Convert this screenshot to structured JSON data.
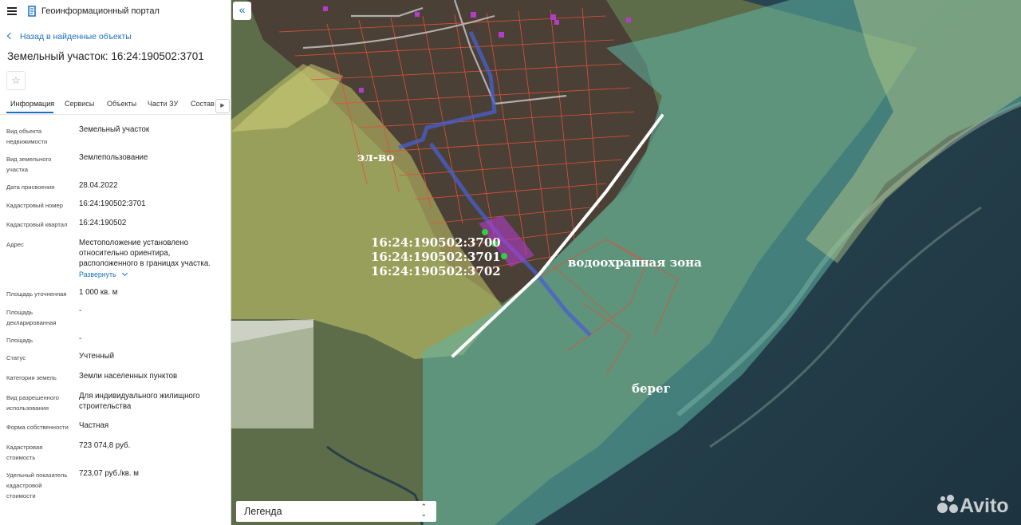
{
  "app": {
    "title": "Геоинформационный портал"
  },
  "nav": {
    "back_label": "Назад в найденные объекты"
  },
  "object": {
    "title": "Земельный участок: 16:24:190502:3701"
  },
  "tabs": [
    {
      "label": "Информация",
      "active": true
    },
    {
      "label": "Сервисы"
    },
    {
      "label": "Объекты"
    },
    {
      "label": "Части ЗУ"
    },
    {
      "label": "Состав"
    }
  ],
  "properties": [
    {
      "label": "Вид объекта недвижимости",
      "value": "Земельный участок"
    },
    {
      "label": "Вид земельного участка",
      "value": "Землепользование"
    },
    {
      "label": "Дата присвоения",
      "value": "28.04.2022"
    },
    {
      "label": "Кадастровый номер",
      "value": "16:24:190502:3701"
    },
    {
      "label": "Кадастровый квартал",
      "value": "16:24:190502"
    },
    {
      "label": "Адрес",
      "value": "Местоположение установлено относительно ориентира, расположенного в границах участка.",
      "action": "Развернуть"
    },
    {
      "label": "Площадь уточненная",
      "value": "1 000 кв. м"
    },
    {
      "label": "Площадь декларированная",
      "value": "-"
    },
    {
      "label": "Площадь",
      "value": "-"
    },
    {
      "label": "Статус",
      "value": "Учтенный"
    },
    {
      "label": "Категория земель",
      "value": "Земли населенных пунктов"
    },
    {
      "label": "Вид разрешенного использования",
      "value": "Для индивидуального жилищного строительства"
    },
    {
      "label": "Форма собственности",
      "value": "Частная"
    },
    {
      "label": "Кадастровая стоимость",
      "value": "723 074,8 руб."
    },
    {
      "label": "Удельный показатель кадастровой стоимости",
      "value": "723,07 руб./кв. м"
    }
  ],
  "map": {
    "collapse_icon": "«",
    "legend_label": "Легенда",
    "legend_arrows": "⌃⌄",
    "annotations": {
      "power_line": "эл-во",
      "parcel_1": "16:24:190502:3700",
      "parcel_2": "16:24:190502:3701",
      "parcel_3": "16:24:190502:3702",
      "water_zone": "водоохранная зона",
      "shore": "берег"
    },
    "watermark": "Avito",
    "colors": {
      "yellow_zone": "#c9c96a",
      "water_zone": "#5fb4a4",
      "parcel_border": "#e0503a",
      "highlight": "#b43cc8",
      "power_line": "#4a5fd0"
    }
  }
}
